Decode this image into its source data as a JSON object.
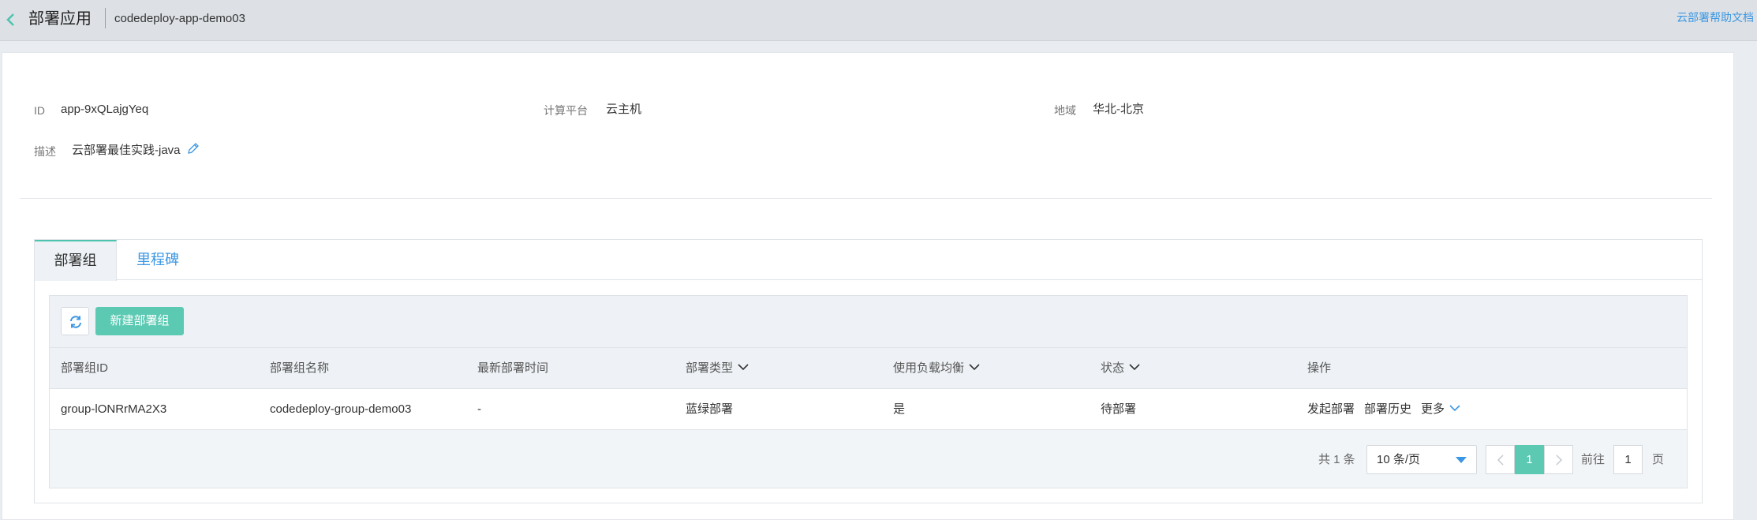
{
  "header": {
    "title": "部署应用",
    "app_name": "codedeploy-app-demo03",
    "help_link": "云部署帮助文档"
  },
  "info": {
    "id_label": "ID",
    "id_value": "app-9xQLajgYeq",
    "platform_label": "计算平台",
    "platform_value": "云主机",
    "region_label": "地域",
    "region_value": "华北-北京",
    "desc_label": "描述",
    "desc_value": "云部署最佳实践-java"
  },
  "tabs": [
    {
      "label": "部署组",
      "active": true
    },
    {
      "label": "里程碑",
      "active": false
    }
  ],
  "toolbar": {
    "new_button": "新建部署组"
  },
  "table": {
    "columns": [
      "部署组ID",
      "部署组名称",
      "最新部署时间",
      "部署类型",
      "使用负载均衡",
      "状态",
      "操作"
    ],
    "rows": [
      {
        "id": "group-lONRrMA2X3",
        "name": "codedeploy-group-demo03",
        "last_deploy": "-",
        "type": "蓝绿部署",
        "load_balancer": "是",
        "status": "待部署",
        "actions": {
          "deploy": "发起部署",
          "history": "部署历史",
          "more": "更多"
        }
      }
    ]
  },
  "pagination": {
    "total": "共 1 条",
    "page_size": "10 条/页",
    "current_page": "1",
    "goto_label": "前往",
    "goto_value": "1",
    "page_unit": "页"
  },
  "colors": {
    "accent_green": "#5cc9b2",
    "link_blue": "#3b97e3"
  }
}
